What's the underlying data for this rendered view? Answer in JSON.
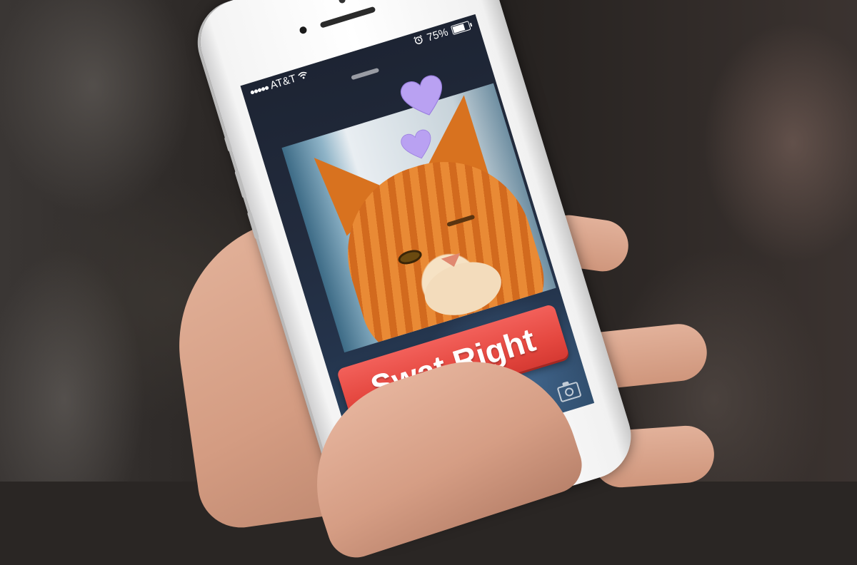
{
  "status_bar": {
    "signal_dots": "●●●●●",
    "carrier": "AT&T",
    "battery_percent": "75%",
    "battery_level": 0.75
  },
  "app": {
    "action_button_label": "Swat Right",
    "heart_color": "#b9a1f2",
    "button_color": "#e54840"
  },
  "icons": [
    "wifi-icon",
    "alarm-icon",
    "battery-icon",
    "heart-icon",
    "camera-icon"
  ]
}
